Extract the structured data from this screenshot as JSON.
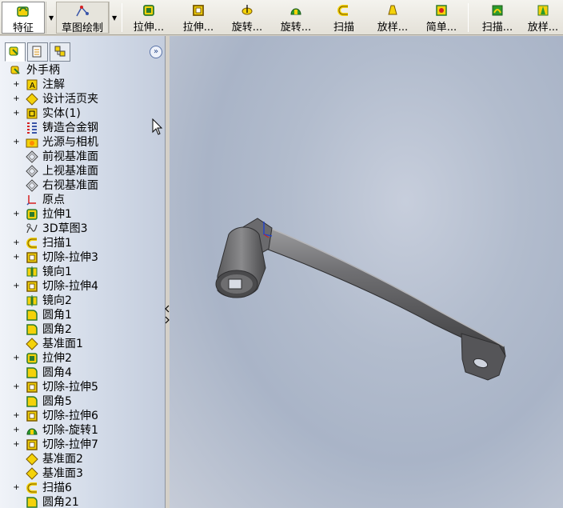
{
  "toolbar": {
    "buttons": [
      {
        "label": "特征",
        "icon": "features-icon"
      },
      {
        "label": "草图绘制",
        "icon": "sketch-icon"
      },
      {
        "label": "拉伸...",
        "icon": "extrude-boss-icon"
      },
      {
        "label": "拉伸...",
        "icon": "extrude-cut-icon"
      },
      {
        "label": "旋转...",
        "icon": "revolve-boss-icon"
      },
      {
        "label": "旋转...",
        "icon": "revolve-cut-icon"
      },
      {
        "label": "扫描",
        "icon": "sweep-icon"
      },
      {
        "label": "放样...",
        "icon": "loft-icon"
      },
      {
        "label": "简单...",
        "icon": "simple-hole-icon"
      },
      {
        "label": "扫描...",
        "icon": "swept-cut-icon"
      },
      {
        "label": "放样...",
        "icon": "lofted-cut-icon"
      }
    ]
  },
  "panel": {
    "tabs": [
      "feature-manager-tab",
      "property-manager-tab",
      "configuration-manager-tab"
    ],
    "root": "外手柄",
    "items": [
      {
        "label": "注解",
        "expand": true,
        "icon": "annotations-icon"
      },
      {
        "label": "设计活页夹",
        "expand": true,
        "icon": "design-binder-icon"
      },
      {
        "label": "实体(1)",
        "expand": true,
        "icon": "solid-bodies-icon"
      },
      {
        "label": "铸造合金钢",
        "expand": false,
        "icon": "material-icon"
      },
      {
        "label": "光源与相机",
        "expand": true,
        "icon": "lights-cameras-icon"
      },
      {
        "label": "前视基准面",
        "expand": false,
        "icon": "plane-icon"
      },
      {
        "label": "上视基准面",
        "expand": false,
        "icon": "plane-icon"
      },
      {
        "label": "右视基准面",
        "expand": false,
        "icon": "plane-icon"
      },
      {
        "label": "原点",
        "expand": false,
        "icon": "origin-icon"
      },
      {
        "label": "拉伸1",
        "expand": true,
        "icon": "extrude-boss-icon"
      },
      {
        "label": "3D草图3",
        "expand": false,
        "icon": "3d-sketch-icon"
      },
      {
        "label": "扫描1",
        "expand": true,
        "icon": "sweep-icon"
      },
      {
        "label": "切除-拉伸3",
        "expand": true,
        "icon": "extrude-cut-icon"
      },
      {
        "label": "镜向1",
        "expand": false,
        "icon": "mirror-icon"
      },
      {
        "label": "切除-拉伸4",
        "expand": true,
        "icon": "extrude-cut-icon"
      },
      {
        "label": "镜向2",
        "expand": false,
        "icon": "mirror-icon"
      },
      {
        "label": "圆角1",
        "expand": false,
        "icon": "fillet-icon"
      },
      {
        "label": "圆角2",
        "expand": false,
        "icon": "fillet-icon"
      },
      {
        "label": "基准面1",
        "expand": false,
        "icon": "ref-plane-icon"
      },
      {
        "label": "拉伸2",
        "expand": true,
        "icon": "extrude-boss-icon"
      },
      {
        "label": "圆角4",
        "expand": false,
        "icon": "fillet-icon"
      },
      {
        "label": "切除-拉伸5",
        "expand": true,
        "icon": "extrude-cut-icon"
      },
      {
        "label": "圆角5",
        "expand": false,
        "icon": "fillet-icon"
      },
      {
        "label": "切除-拉伸6",
        "expand": true,
        "icon": "extrude-cut-icon"
      },
      {
        "label": "切除-旋转1",
        "expand": true,
        "icon": "revolve-cut-icon"
      },
      {
        "label": "切除-拉伸7",
        "expand": true,
        "icon": "extrude-cut-icon"
      },
      {
        "label": "基准面2",
        "expand": false,
        "icon": "ref-plane-icon"
      },
      {
        "label": "基准面3",
        "expand": false,
        "icon": "ref-plane-icon"
      },
      {
        "label": "扫描6",
        "expand": true,
        "icon": "sweep-icon"
      },
      {
        "label": "圆角21",
        "expand": false,
        "icon": "fillet-icon"
      }
    ]
  },
  "colors": {
    "toolbar_bg": "#ece9e2",
    "panel_bg": "#d4dce9",
    "viewport_bg": "#b2bccd",
    "model_gray": "#5c5c5e",
    "feature_yellow": "#f4d20a"
  }
}
